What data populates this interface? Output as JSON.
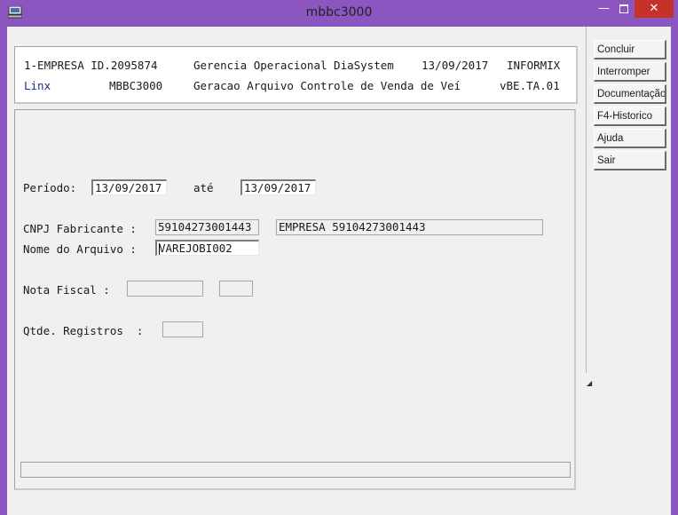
{
  "window": {
    "title": "mbbc3000"
  },
  "header": {
    "line1_left": "1-EMPRESA ID.2095874",
    "line1_center": "Gerencia Operacional DiaSystem",
    "line1_date": "13/09/2017",
    "line1_db": "INFORMIX",
    "line2_brand": "Linx",
    "line2_program": "MBBC3000",
    "line2_center": "Geracao Arquivo Controle de Venda de Veí",
    "line2_version": "vBE.TA.01"
  },
  "form": {
    "periodo_label": "Período:",
    "periodo_from": "13/09/2017",
    "periodo_sep": "até",
    "periodo_to": "13/09/2017",
    "cnpj_label": "CNPJ Fabricante :",
    "cnpj_value": "59104273001443",
    "cnpj_name": "EMPRESA 59104273001443",
    "arquivo_label": "Nome do Arquivo :",
    "arquivo_value": "VAREJOBI002",
    "nota_label": "Nota Fiscal :",
    "nota_value": "",
    "nota_serie": "",
    "qtde_label": "Qtde. Registros  :",
    "qtde_value": ""
  },
  "status": {
    "text": ""
  },
  "sidebar": {
    "buttons": [
      {
        "label": "Concluir"
      },
      {
        "label": "Interromper"
      },
      {
        "label": "Documentação"
      },
      {
        "label": "F4-Historico"
      },
      {
        "label": "Ajuda"
      },
      {
        "label": "Sair"
      }
    ]
  },
  "colors": {
    "titlebar": "#8b56bf",
    "close": "#c7312b",
    "brand_text": "#1c2a8c"
  }
}
